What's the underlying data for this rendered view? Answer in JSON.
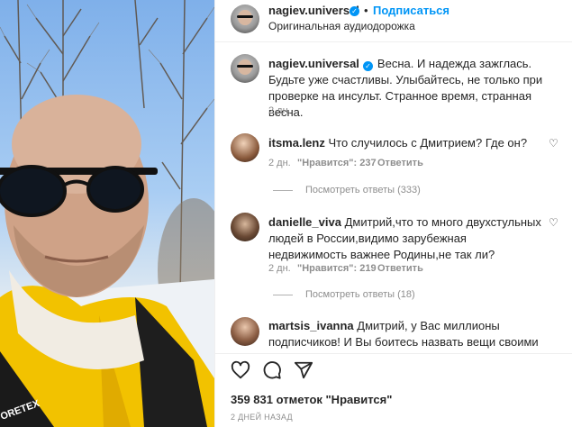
{
  "header": {
    "username": "nagiev.universal",
    "separator": "•",
    "follow_label": "Подписаться",
    "audio_label": "Оригинальная аудиодорожка"
  },
  "caption": {
    "username": "nagiev.universal",
    "text": "Весна. И надежда зажглась. Будьте уже счастливы. Улыбайтесь, не только при проверке на инсульт. Странное время, странная весна.",
    "time": "2 дн."
  },
  "comments": [
    {
      "username": "itsma.lenz",
      "text": "Что случилось с Дмитрием? Где он?",
      "time": "2 дн.",
      "likes_label": "\"Нравится\": 237",
      "reply_label": "Ответить",
      "view_replies": "Посмотреть ответы (333)"
    },
    {
      "username": "danielle_viva",
      "text": "Дмитрий,что то много двухстульных людей в России,видимо зарубежная недвижимость важнее Родины,не так ли?",
      "time": "2 дн.",
      "likes_label": "\"Нравится\": 219",
      "reply_label": "Ответить",
      "view_replies": "Посмотреть ответы (18)"
    },
    {
      "username": "martsis_ivanna",
      "text": "Дмитрий, у Вас миллионы подписчиков! И Вы боитесь назвать вещи своими именами! Назвать войну -"
    }
  ],
  "actions": {
    "like_icon": "heart-icon",
    "comment_icon": "comment-bubble-icon",
    "share_icon": "paper-plane-icon"
  },
  "likes_text": "359 831 отметок \"Нравится\"",
  "date_text": "2 ДНЕЙ НАЗАД",
  "colors": {
    "link_blue": "#0095f6",
    "text": "#262626",
    "muted": "#8e8e8e",
    "jacket_yellow": "#f2c200"
  }
}
